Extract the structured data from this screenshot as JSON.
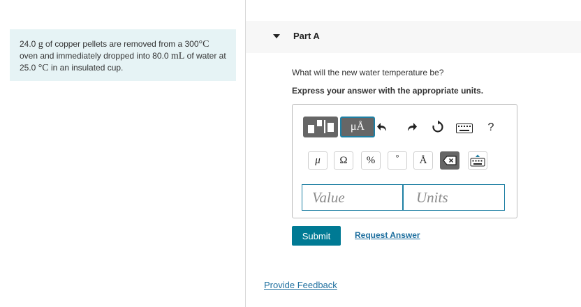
{
  "problem": {
    "text_1": "24.0",
    "unit_g": "g",
    "text_2": "of copper pellets are removed from a",
    "temp_1": "300",
    "unit_c1": "°C",
    "text_3": "oven and immediately dropped into",
    "volume": "80.0",
    "unit_ml": "mL",
    "text_4": "of water at",
    "temp_2": "25.0",
    "unit_c2": "°C",
    "text_5": "in an insulated cup."
  },
  "part": {
    "title": "Part A",
    "question": "What will the new water temperature be?",
    "instruction": "Express your answer with the appropriate units."
  },
  "toolbar": {
    "units_template_label": "μÅ",
    "keyboard_label": "?"
  },
  "symbols": {
    "mu": "μ",
    "omega": "Ω",
    "percent": "%",
    "degree": "°",
    "angstrom": "Å"
  },
  "inputs": {
    "value_placeholder": "Value",
    "units_placeholder": "Units"
  },
  "actions": {
    "submit_label": "Submit",
    "request_answer_label": "Request Answer",
    "feedback_label": "Provide Feedback"
  },
  "colors": {
    "accent": "#007a94",
    "link": "#1e6f9f",
    "problem_bg": "#e6f3f5",
    "toolbar_button": "#666666"
  }
}
